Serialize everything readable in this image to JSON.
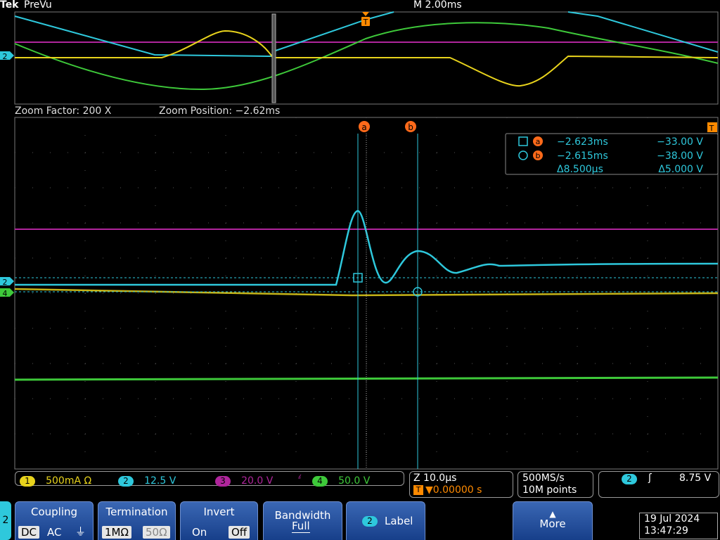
{
  "header": {
    "brand": "Tek",
    "mode": "PreVu",
    "timebase": "M 2.00ms"
  },
  "zoom": {
    "factor": "Zoom Factor: 200 X",
    "position": "Zoom Position: −2.62ms"
  },
  "markers": {
    "trigger": "T",
    "cursor_a": "a",
    "cursor_b": "b",
    "ch2": "2",
    "ch4": "4"
  },
  "cursor_readout": {
    "a_time": "−2.623ms",
    "a_volt": "−33.00 V",
    "b_time": "−2.615ms",
    "b_volt": "−38.00 V",
    "delta_time": "Δ8.500µs",
    "delta_volt": "Δ5.000 V"
  },
  "channels": [
    {
      "num": "1",
      "scale": "500mA Ω",
      "color": "#e8d31c"
    },
    {
      "num": "2",
      "scale": "12.5 V",
      "color": "#2ec8dc"
    },
    {
      "num": "3",
      "scale": "20.0 V",
      "color": "#b0259c"
    },
    {
      "num": "4",
      "scale": "50.0 V",
      "color": "#3ec93a"
    }
  ],
  "horizontal": {
    "zoom_scale": "Z 10.0µs",
    "trigger_pos": "▼0.00000 s",
    "sample_rate": "500MS/s",
    "record": "10M points"
  },
  "trigger": {
    "channel": "2",
    "slope": "ʃ",
    "level": "8.75 V"
  },
  "menu": {
    "channel_tab": "2",
    "coupling": {
      "title": "Coupling",
      "dc": "DC",
      "ac": "AC",
      "gnd": "⏚"
    },
    "termination": {
      "title": "Termination",
      "opt1": "1MΩ",
      "opt2": "50Ω"
    },
    "invert": {
      "title": "Invert",
      "on": "On",
      "off": "Off"
    },
    "bandwidth": {
      "title": "Bandwidth",
      "value": "Full"
    },
    "label": {
      "badge": "2",
      "title": "Label"
    },
    "more": {
      "title": "More"
    }
  },
  "datetime": {
    "date": "19 Jul  2024",
    "time": "13:47:29"
  }
}
